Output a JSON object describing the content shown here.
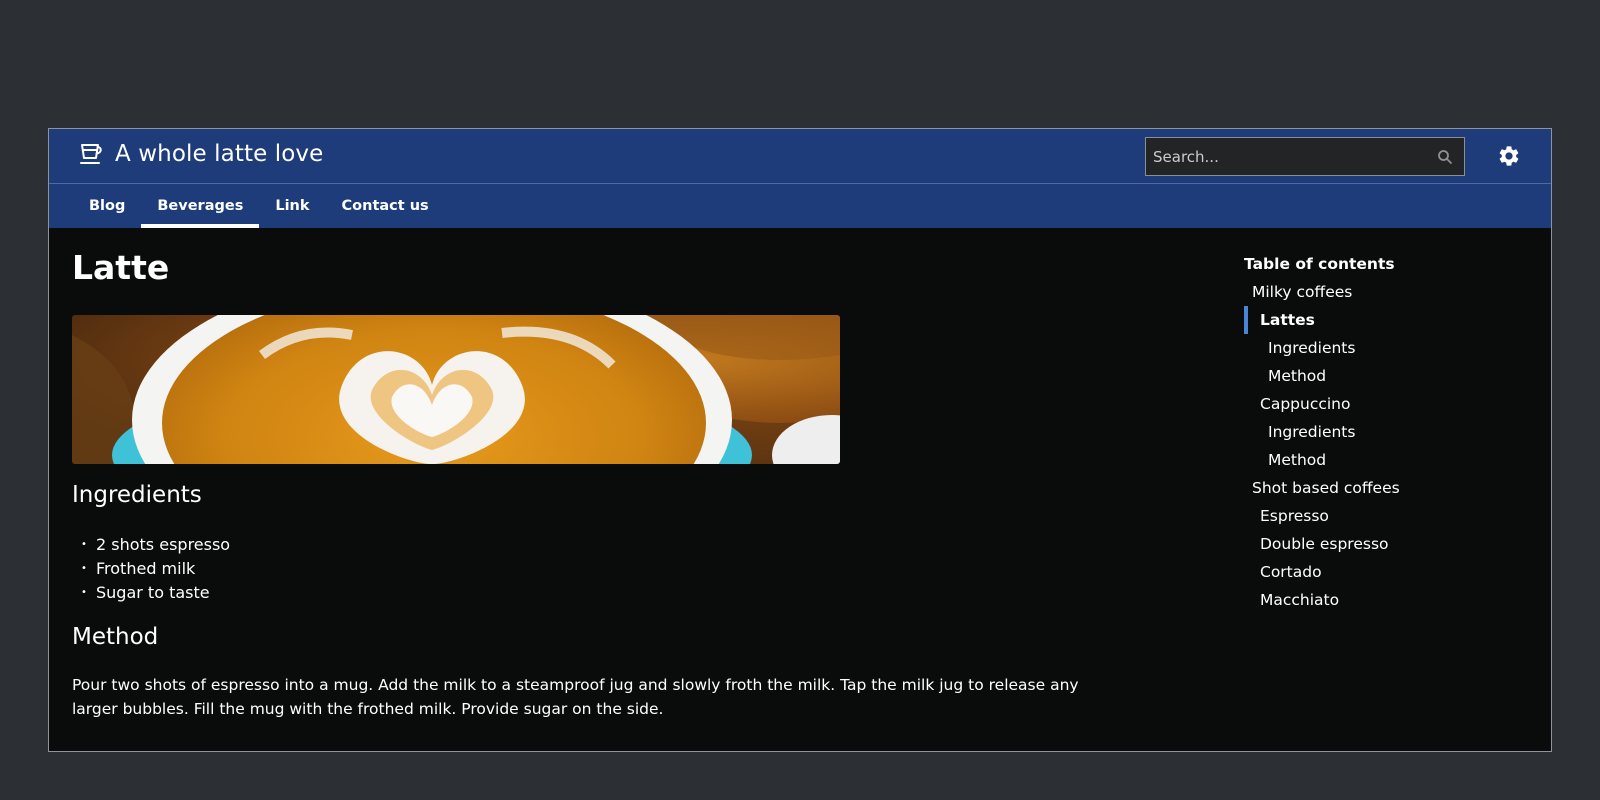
{
  "header": {
    "brand_icon": "coffee-cup-icon",
    "title": "A whole latte love",
    "search_placeholder": "Search...",
    "search_icon": "search-icon",
    "settings_icon": "gear-icon"
  },
  "nav": {
    "items": [
      {
        "label": "Blog",
        "active": false
      },
      {
        "label": "Beverages",
        "active": true
      },
      {
        "label": "Link",
        "active": false
      },
      {
        "label": "Contact us",
        "active": false
      }
    ]
  },
  "main": {
    "title": "Latte",
    "ingredients_heading": "Ingredients",
    "ingredients": [
      "2 shots espresso",
      "Frothed milk",
      "Sugar to taste"
    ],
    "method_heading": "Method",
    "method_text": "Pour two shots of espresso into a mug. Add the milk to a steamproof jug and slowly froth the milk. Tap the milk jug to release any larger bubbles. Fill the mug with the frothed milk. Provide sugar on the side."
  },
  "toc": {
    "title": "Table of contents",
    "items": [
      {
        "label": "Milky coffees",
        "level": 1,
        "active": false
      },
      {
        "label": "Lattes",
        "level": 2,
        "active": true
      },
      {
        "label": "Ingredients",
        "level": 3,
        "active": false
      },
      {
        "label": "Method",
        "level": 3,
        "active": false
      },
      {
        "label": "Cappuccino",
        "level": 2,
        "active": false
      },
      {
        "label": "Ingredients",
        "level": 3,
        "active": false
      },
      {
        "label": "Method",
        "level": 3,
        "active": false
      },
      {
        "label": "Shot based coffees",
        "level": 1,
        "active": false
      },
      {
        "label": "Espresso",
        "level": 2,
        "active": false
      },
      {
        "label": "Double espresso",
        "level": 2,
        "active": false
      },
      {
        "label": "Cortado",
        "level": 2,
        "active": false
      },
      {
        "label": "Macchiato",
        "level": 2,
        "active": false
      }
    ]
  },
  "colors": {
    "header_bg": "#1e3b7a",
    "page_bg": "#0a0c0c",
    "toc_active_bar": "#4a86d8",
    "outer_bg": "#2c2f34"
  }
}
